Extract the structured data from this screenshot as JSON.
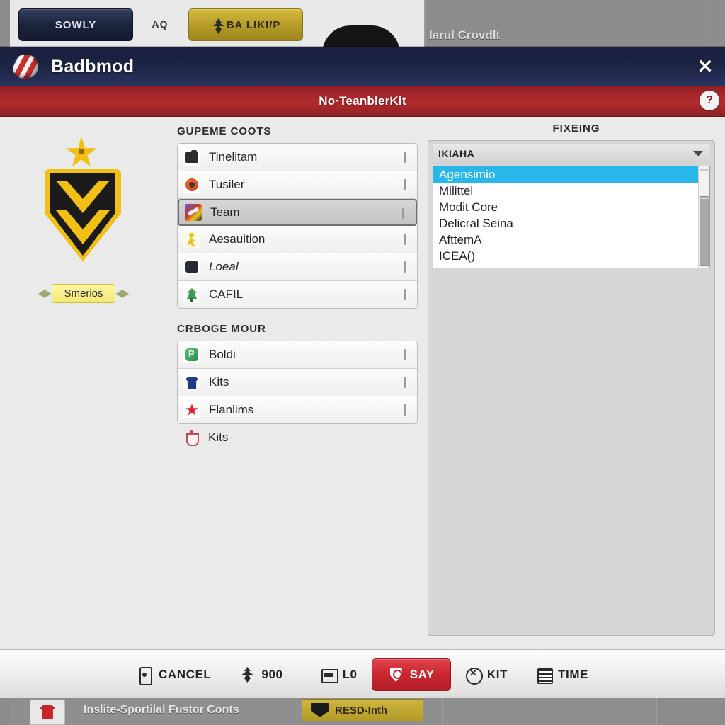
{
  "background": {
    "tabs": [
      {
        "label": "SOWLY",
        "icon": "none"
      },
      {
        "label": "AQ",
        "icon": "none"
      },
      {
        "label": "BA LIKI/P",
        "icon": "lightning-icon"
      }
    ],
    "crowd_label": "larul Crovdlt",
    "bottom_text": "Inslite-Sportilal Fustor Conts",
    "bottom_button": "RESD-Inth"
  },
  "modal": {
    "title": "Badbmod",
    "logo_icon": "striped-ball-icon",
    "close_icon": "close-icon",
    "subtitle": "No·TeanblerKit",
    "help_icon": "help-icon"
  },
  "crest": {
    "label": "Smerios",
    "star_icon": "star-icon",
    "shield_icon": "shield-crest-icon",
    "leaf_icon": "laurel-leaf-icon"
  },
  "center": {
    "group1_title": "GUPEME COOTS",
    "group1_items": [
      {
        "label": "Tinelitam",
        "icon": "bag-icon",
        "icon_class": "ic-bag",
        "selected": false
      },
      {
        "label": "Tusiler",
        "icon": "ball-icon",
        "icon_class": "ic-ball",
        "selected": false
      },
      {
        "label": "Team",
        "icon": "team-icon",
        "icon_class": "ic-team",
        "selected": true
      },
      {
        "label": "Aesauition",
        "icon": "runner-icon",
        "icon_class": "ic-run",
        "selected": false
      },
      {
        "label": "Loeal",
        "icon": "dark-square-icon",
        "icon_class": "ic-dark",
        "selected": false
      },
      {
        "label": "CAFIL",
        "icon": "tree-icon",
        "icon_class": "ic-tree",
        "selected": false
      }
    ],
    "group2_title": "CRBOGE MOUR",
    "group2_items": [
      {
        "label": "Boldi",
        "icon": "green-pitch-icon",
        "icon_class": "ic-green"
      },
      {
        "label": "Kits",
        "icon": "shirt-icon",
        "icon_class": "ic-shirt"
      },
      {
        "label": "Flanlims",
        "icon": "red-star-icon",
        "icon_class": "ic-star"
      }
    ],
    "extra_item": {
      "label": "Kits",
      "icon": "trophy-icon",
      "icon_class": "ic-trophy"
    }
  },
  "right": {
    "title": "FIXEING",
    "combo_value": "IKIAHA",
    "combo_arrow_icon": "chevron-down-icon",
    "list_items": [
      {
        "label": "Agensimio",
        "selected": true
      },
      {
        "label": "Milittel",
        "selected": false
      },
      {
        "label": "Modit Core",
        "selected": false
      },
      {
        "label": "Delicral Seina",
        "selected": false
      },
      {
        "label": "AfttemA",
        "selected": false
      },
      {
        "label": "ICEA()",
        "selected": false
      }
    ]
  },
  "footer": {
    "buttons": [
      {
        "label": "Cancel",
        "icon": "phone-icon",
        "icon_class": "fic-phone",
        "primary": false
      },
      {
        "label": "900",
        "icon": "lightning-icon",
        "icon_class": "fic-bolt",
        "primary": false
      },
      {
        "label": "l0",
        "icon": "card-icon",
        "icon_class": "fic-card",
        "primary": false
      },
      {
        "label": "Say",
        "icon": "shield-icon",
        "icon_class": "fic-shield",
        "primary": true
      },
      {
        "label": "Kit",
        "icon": "whistle-icon",
        "icon_class": "fic-circx",
        "primary": false
      },
      {
        "label": "Time",
        "icon": "list-icon",
        "icon_class": "fic-list",
        "primary": false
      }
    ]
  },
  "colors": {
    "title_blue": "#1c2444",
    "sub_red": "#a8282b",
    "accent_red": "#c9262f",
    "select_blue": "#29b6e8",
    "crest_yellow": "#f2c014"
  }
}
